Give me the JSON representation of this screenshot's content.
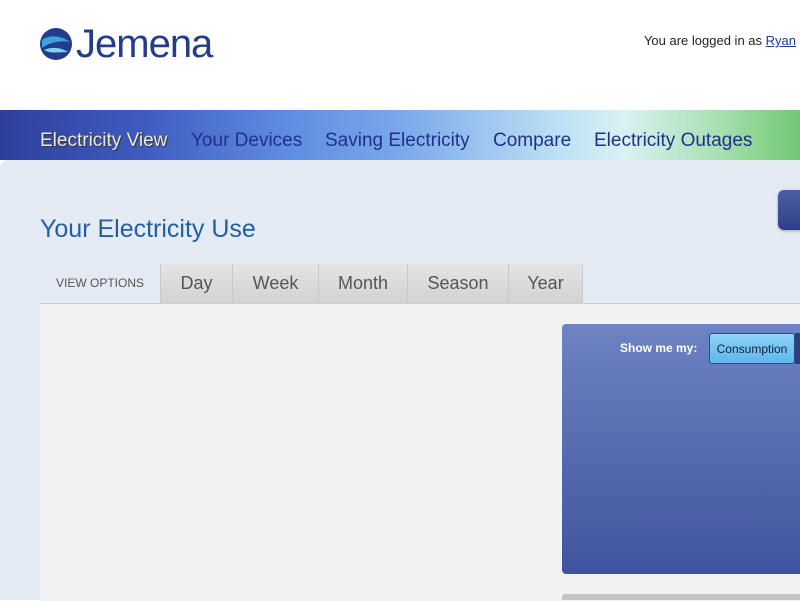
{
  "header": {
    "logo_text": "Jemena",
    "login_prefix": "You are logged in as",
    "user_name": "Ryan"
  },
  "nav": {
    "items": [
      {
        "label": "Electricity View",
        "active": true
      },
      {
        "label": "Your Devices",
        "active": false
      },
      {
        "label": "Saving Electricity",
        "active": false
      },
      {
        "label": "Compare",
        "active": false
      },
      {
        "label": "Electricity Outages",
        "active": false
      }
    ]
  },
  "main": {
    "title": "Your Electricity Use",
    "view_options_label": "VIEW OPTIONS",
    "tabs": [
      {
        "label": "Day"
      },
      {
        "label": "Week"
      },
      {
        "label": "Month"
      },
      {
        "label": "Season"
      },
      {
        "label": "Year"
      }
    ],
    "show_me_label": "Show me my:",
    "consumption_label": "Consumption"
  },
  "colors": {
    "brand": "#243c8a",
    "title": "#1f5fa6",
    "panel": "#40539e",
    "button": "#5db7ee"
  }
}
